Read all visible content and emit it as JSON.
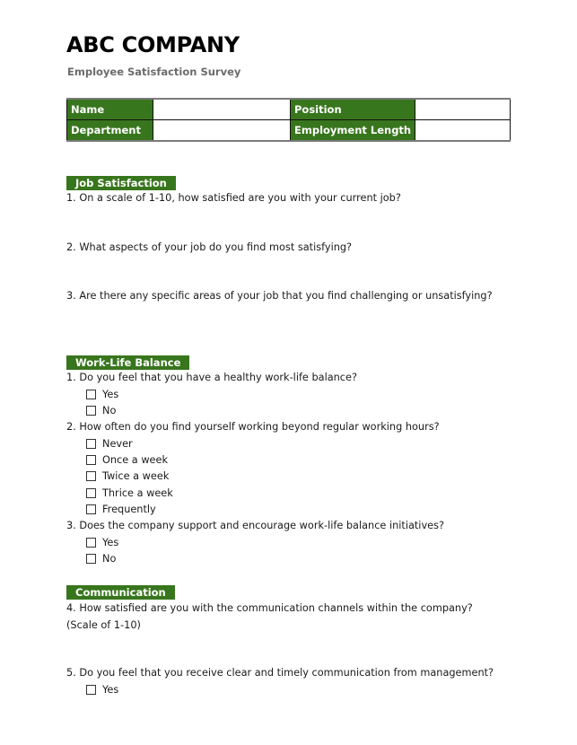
{
  "header": {
    "title": "ABC COMPANY",
    "subtitle": "Employee Satisfaction Survey"
  },
  "info_table": {
    "rows": [
      {
        "label1": "Name",
        "value1": "",
        "label2": "Position",
        "value2": ""
      },
      {
        "label1": "Department",
        "value1": "",
        "label2": "Employment Length",
        "value2": ""
      }
    ]
  },
  "colors": {
    "accent": "#38761d",
    "subtitle": "#6b6b6b"
  },
  "sections": {
    "job": {
      "title": "Job Satisfaction",
      "questions": [
        "1. On a scale of 1-10, how satisfied are you with your current job?",
        "2. What aspects of your job do you find most satisfying?",
        "3. Are there any specific areas of your job that you find challenging or unsatisfying?"
      ]
    },
    "wlb": {
      "title": "Work-Life Balance",
      "q1": "1. Do you feel that you have a healthy work-life balance?",
      "q1_options": [
        "Yes",
        "No"
      ],
      "q2": "2. How often do you find yourself working beyond regular working hours?",
      "q2_options": [
        "Never",
        "Once a week",
        "Twice a week",
        "Thrice a week",
        "Frequently"
      ],
      "q3": "3. Does the company support and encourage work-life balance initiatives?",
      "q3_options": [
        "Yes",
        "No"
      ]
    },
    "comm": {
      "title": "Communication",
      "q4": "4. How satisfied are you with the communication channels within the company? (Scale of 1-10)",
      "q5": "5. Do you feel that you receive clear and timely communication from management?",
      "q5_options": [
        "Yes"
      ]
    }
  }
}
